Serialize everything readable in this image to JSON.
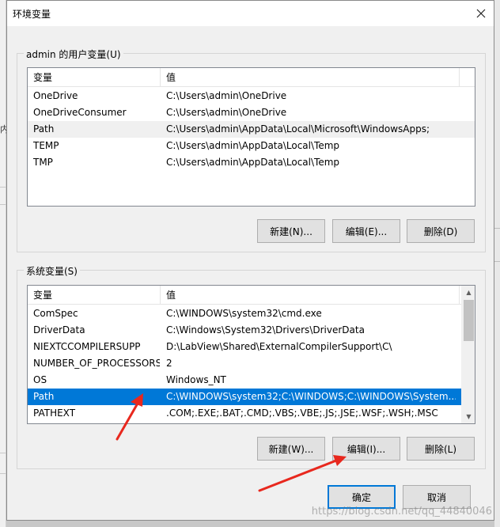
{
  "window": {
    "title": "环境变量",
    "close_icon": "close-icon"
  },
  "background": {
    "left_glyph": "内"
  },
  "user_vars": {
    "legend": "admin 的用户变量(U)",
    "columns": [
      "变量",
      "值"
    ],
    "rows": [
      {
        "name": "OneDrive",
        "value": "C:\\Users\\admin\\OneDrive"
      },
      {
        "name": "OneDriveConsumer",
        "value": "C:\\Users\\admin\\OneDrive"
      },
      {
        "name": "Path",
        "value": "C:\\Users\\admin\\AppData\\Local\\Microsoft\\WindowsApps;"
      },
      {
        "name": "TEMP",
        "value": "C:\\Users\\admin\\AppData\\Local\\Temp"
      },
      {
        "name": "TMP",
        "value": "C:\\Users\\admin\\AppData\\Local\\Temp"
      }
    ],
    "buttons": {
      "new": "新建(N)...",
      "edit": "编辑(E)...",
      "delete": "删除(D)"
    }
  },
  "system_vars": {
    "legend": "系统变量(S)",
    "columns": [
      "变量",
      "值"
    ],
    "rows": [
      {
        "name": "ComSpec",
        "value": "C:\\WINDOWS\\system32\\cmd.exe"
      },
      {
        "name": "DriverData",
        "value": "C:\\Windows\\System32\\Drivers\\DriverData"
      },
      {
        "name": "NIEXTCCOMPILERSUPP",
        "value": "D:\\LabView\\Shared\\ExternalCompilerSupport\\C\\"
      },
      {
        "name": "NUMBER_OF_PROCESSORS",
        "value": "2"
      },
      {
        "name": "OS",
        "value": "Windows_NT"
      },
      {
        "name": "Path",
        "value": "C:\\WINDOWS\\system32;C:\\WINDOWS;C:\\WINDOWS\\System..."
      },
      {
        "name": "PATHEXT",
        "value": ".COM;.EXE;.BAT;.CMD;.VBS;.VBE;.JS;.JSE;.WSF;.WSH;.MSC"
      }
    ],
    "selected_row": "Path",
    "buttons": {
      "new": "新建(W)...",
      "edit": "编辑(I)...",
      "delete": "删除(L)"
    }
  },
  "footer": {
    "ok": "确定",
    "cancel": "取消"
  },
  "watermark": "https://blog.csdn.net/qq_44840046",
  "colors": {
    "selection": "#0078d7",
    "hover_row": "#e5f3ff",
    "annotation_arrow": "#e8281e"
  }
}
